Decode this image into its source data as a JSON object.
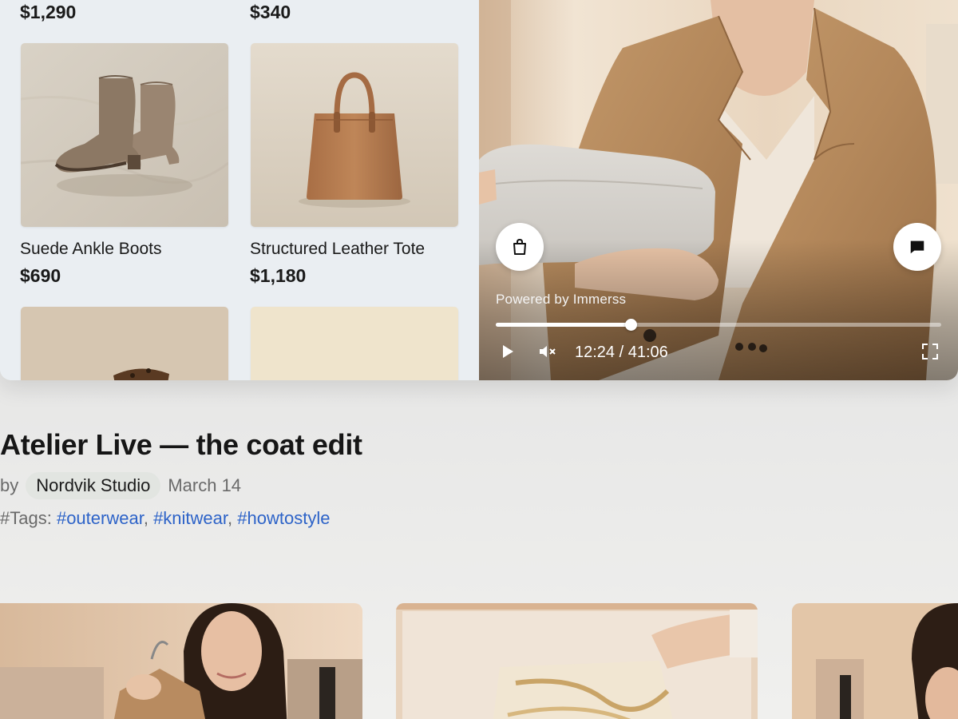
{
  "products": {
    "top_prices": [
      "$1,290",
      "$340"
    ],
    "items": [
      {
        "name": "Suede Ankle Boots",
        "price": "$690"
      },
      {
        "name": "Structured Leather Tote",
        "price": "$1,180"
      }
    ]
  },
  "video": {
    "powered_by": "Powered by Immerss",
    "time_display": "12:24 / 41:06",
    "progress": 0.302,
    "icons": {
      "shop": "shopping-bag-icon",
      "chat": "chat-bubble-icon",
      "play": "play-icon",
      "mute": "mute-icon",
      "fullscreen": "fullscreen-icon"
    }
  },
  "details": {
    "title": "Atelier Live — the coat edit",
    "by": "by",
    "author": "Nordvik Studio",
    "date": "March 14",
    "tags_label": "#Tags:",
    "tags": [
      "#outerwear",
      "#knitwear",
      "#howtostyle"
    ]
  },
  "colors": {
    "tag_link": "#2d63c8",
    "author_chip": "#e2e5e1",
    "panel": "#eaeef2"
  }
}
